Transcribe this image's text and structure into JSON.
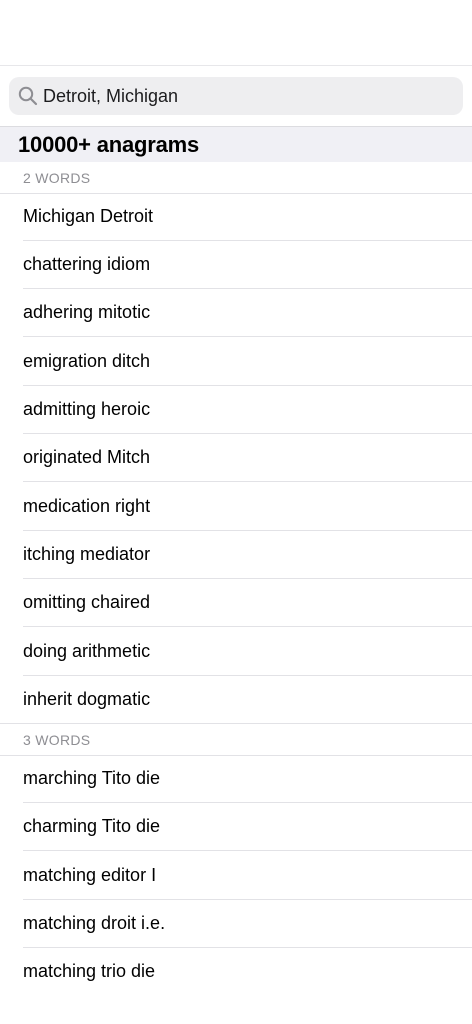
{
  "search": {
    "value": "Detroit, Michigan",
    "icon": "magnifying-glass"
  },
  "results": {
    "title": "10000+ anagrams"
  },
  "sections": [
    {
      "header": "2 WORDS",
      "items": [
        "Michigan Detroit",
        "chattering idiom",
        "adhering mitotic",
        "emigration ditch",
        "admitting heroic",
        "originated Mitch",
        "medication right",
        "itching mediator",
        "omitting chaired",
        "doing arithmetic",
        "inherit dogmatic"
      ]
    },
    {
      "header": "3 WORDS",
      "items": [
        "marching Tito die",
        "charming Tito die",
        "matching editor I",
        "matching droit i.e.",
        "matching trio die"
      ]
    }
  ]
}
